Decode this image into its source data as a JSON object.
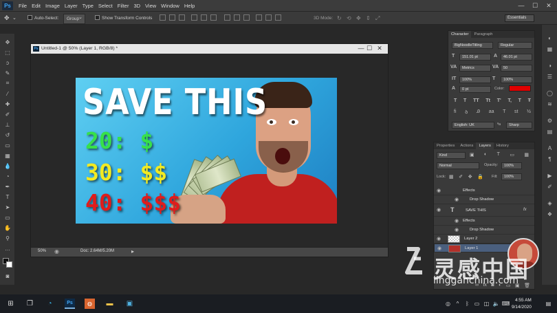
{
  "menu": {
    "app_icon": "Ps",
    "items": [
      "File",
      "Edit",
      "Image",
      "Layer",
      "Type",
      "Select",
      "Filter",
      "3D",
      "View",
      "Window",
      "Help"
    ],
    "minimize": "—",
    "maximize": "☐",
    "close": "✕"
  },
  "options": {
    "auto_select": "Auto-Select:",
    "group": "Group",
    "transform": "Show Transform Controls",
    "mode3d": "3D Mode:",
    "workspace": "Essentials"
  },
  "document": {
    "title": "Untitled-1 @ 50% (Layer 1, RGB/8) *",
    "zoom": "50%",
    "doc_info": "Doc: 2.64M/5.20M"
  },
  "thumbnail": {
    "headline": "SAVE THIS",
    "price_20": "20: $",
    "price_30": "30: $$",
    "price_40": "40: $$$"
  },
  "character": {
    "tab_character": "Character",
    "tab_paragraph": "Paragraph",
    "font_family": "BigNoodleTitling",
    "font_style": "Regular",
    "font_size": "151.01 pt",
    "leading": "46.01 pt",
    "kerning": "Metrics",
    "tracking": "50",
    "vscale": "100%",
    "hscale": "100%",
    "baseline": "0 pt",
    "color_label": "Color:",
    "color": "#e00000",
    "language": "English: UK",
    "aa_label": "ªa",
    "aa": "Sharp"
  },
  "layers": {
    "tabs": [
      "Properties",
      "Actions",
      "Layers",
      "History"
    ],
    "kind": "Kind",
    "blend": "Normal",
    "opacity_label": "Opacity:",
    "opacity": "100%",
    "lock_label": "Lock:",
    "fill_label": "Fill:",
    "fill": "100%",
    "rows": [
      {
        "name": "Effects"
      },
      {
        "name": "Drop Shadow"
      },
      {
        "name": "SAVE THIS"
      },
      {
        "name": "Effects"
      },
      {
        "name": "Drop Shadow"
      },
      {
        "name": "Layer 2"
      },
      {
        "name": "Layer 1"
      }
    ],
    "fx": "fx"
  },
  "watermark": {
    "cn": "灵感中国",
    "en": "lingganchina.com"
  },
  "taskbar": {
    "time": "4:55 AM",
    "date": "9/14/2020"
  }
}
